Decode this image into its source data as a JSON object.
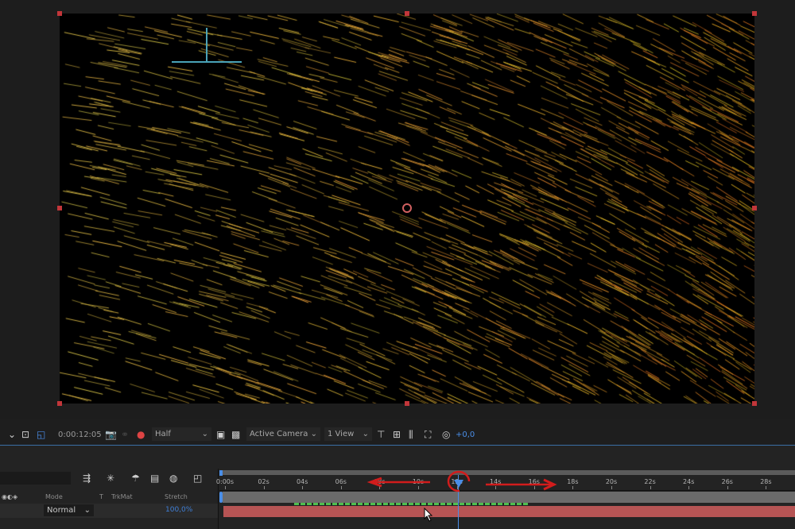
{
  "viewer": {
    "name": "composition-viewer"
  },
  "toolbar": {
    "timecode": "0:00:12:05",
    "resolution": "Half",
    "camera": "Active Camera",
    "views": "1 View",
    "exposure": "+0,0"
  },
  "timeline": {
    "ruler_labels": [
      "0:00s",
      "02s",
      "04s",
      "06s",
      "08s",
      "10s",
      "12s",
      "14s",
      "16s",
      "18s",
      "20s",
      "22s",
      "24s",
      "26s",
      "28s"
    ],
    "current_time_seconds": 12.2,
    "columns": {
      "mode": "Mode",
      "t": "T",
      "trkmat": "TrkMat",
      "stretch": "Stretch"
    },
    "layer": {
      "mode": "Normal",
      "stretch": "100,0%"
    }
  },
  "colors": {
    "layer_bar": "#b65454",
    "playhead": "#4a8ee8",
    "annotation": "#d21c1c",
    "handle": "#c2363a"
  },
  "annotations": {
    "left_arrow": "arrow-left",
    "right_arrow": "arrow-right",
    "circle": "circle-highlight"
  }
}
